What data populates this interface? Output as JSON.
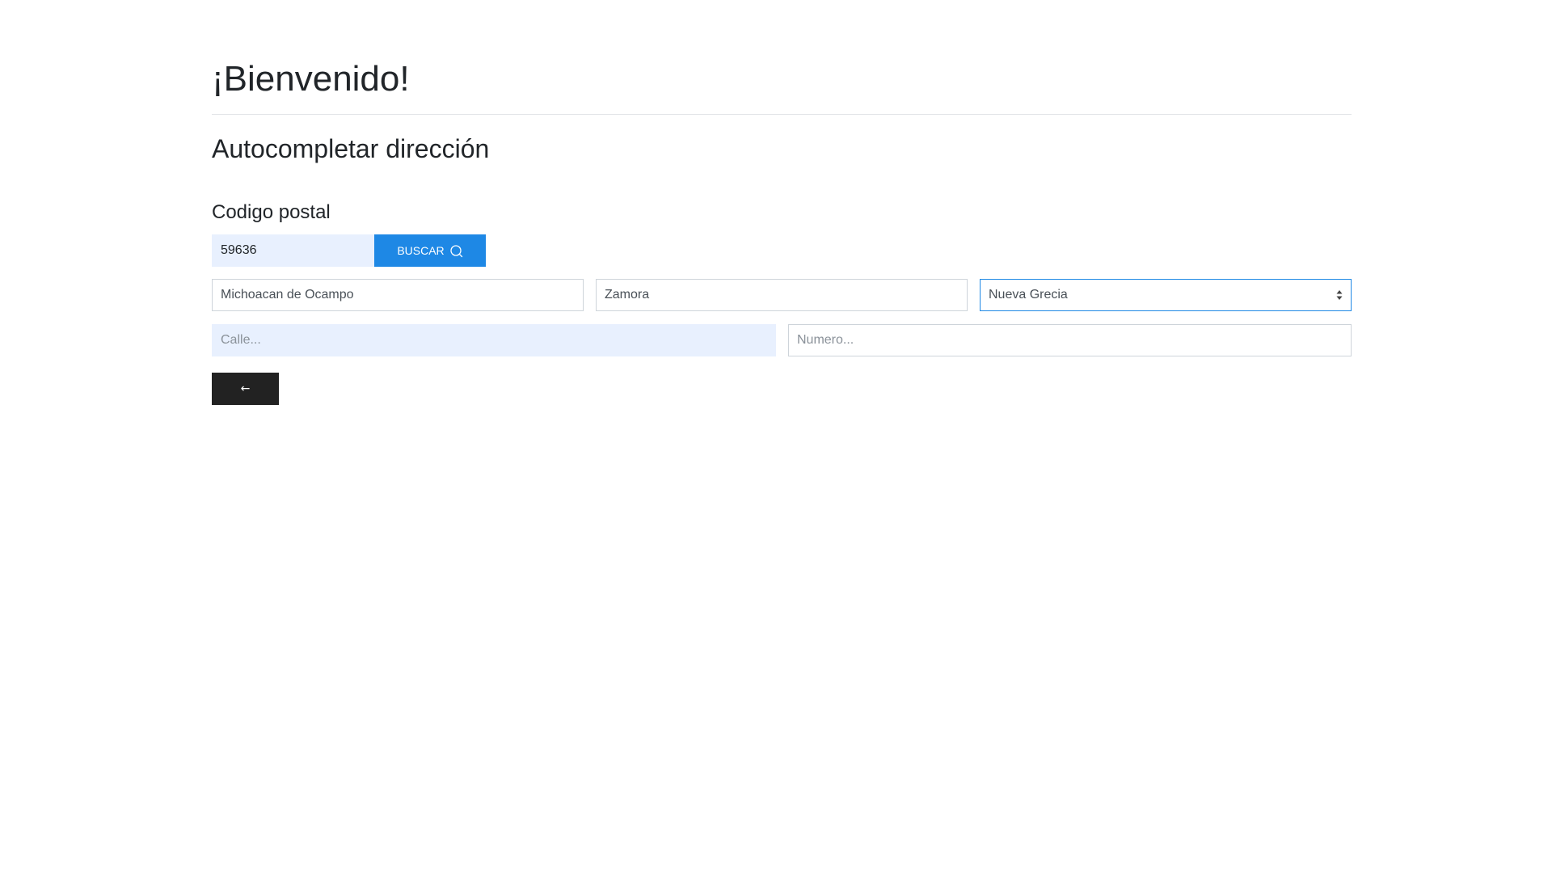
{
  "header": {
    "title": "¡Bienvenido!"
  },
  "section": {
    "title": "Autocompletar dirección"
  },
  "zip": {
    "label": "Codigo postal",
    "value": "59636",
    "button_label": "BUSCAR",
    "button_icon": "search-icon"
  },
  "address": {
    "state": "Michoacan de Ocampo",
    "city": "Zamora",
    "colony_selected": "Nueva Grecia",
    "street_placeholder": "Calle...",
    "number_placeholder": "Numero..."
  },
  "back": {
    "label": "←",
    "icon": "arrow-left-icon"
  },
  "colors": {
    "accent": "#1e88e5",
    "autofill_background": "#e8f0fe",
    "back_button": "#222222",
    "border": "#ced4da"
  }
}
